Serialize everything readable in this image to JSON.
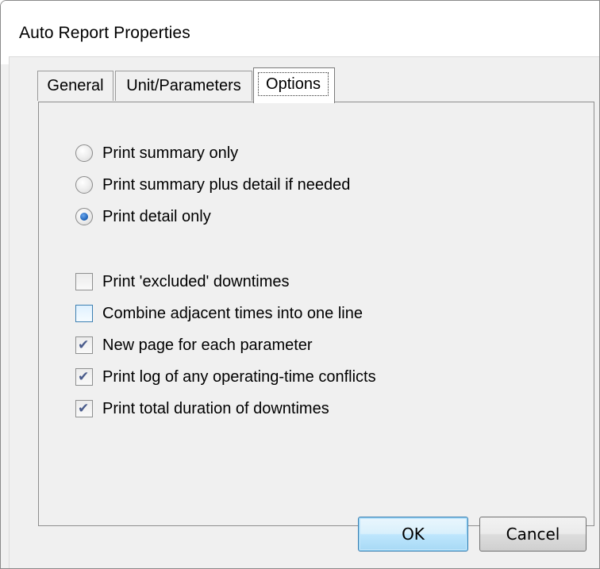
{
  "window": {
    "title": "Auto Report Properties"
  },
  "tabs": [
    {
      "label": "General",
      "selected": false
    },
    {
      "label": "Unit/Parameters",
      "selected": false
    },
    {
      "label": "Options",
      "selected": true
    }
  ],
  "radio_options": [
    {
      "label": "Print summary only",
      "checked": false
    },
    {
      "label": "Print summary plus detail if needed",
      "checked": false
    },
    {
      "label": "Print detail only",
      "checked": true
    }
  ],
  "checkbox_options": [
    {
      "label": "Print 'excluded' downtimes",
      "checked": false
    },
    {
      "label": "Combine adjacent times into one line",
      "checked": false
    },
    {
      "label": "New page for each parameter",
      "checked": true
    },
    {
      "label": "Print log of any operating-time conflicts",
      "checked": true
    },
    {
      "label": "Print total duration of downtimes",
      "checked": true
    }
  ],
  "buttons": {
    "ok_label": "OK",
    "cancel_label": "Cancel"
  },
  "colors": {
    "dialog_background": "#f0f0f0",
    "default_button_border": "#3c7fb1",
    "radio_selected": "#1b5fb4"
  }
}
